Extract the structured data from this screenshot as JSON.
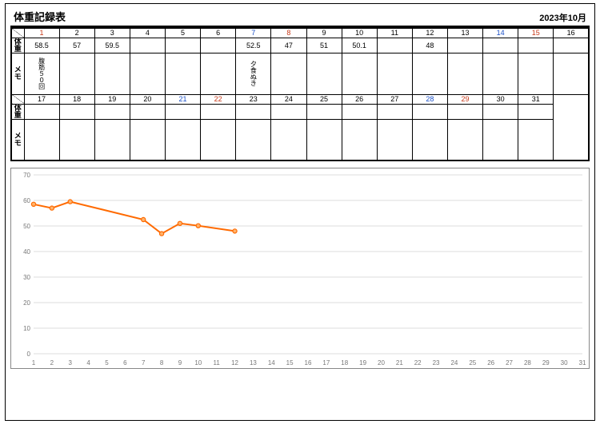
{
  "header": {
    "title": "体重記録表",
    "month": "2023年10月"
  },
  "labels": {
    "weight": "体重",
    "memo": "メモ"
  },
  "days_row1": [
    "1",
    "2",
    "3",
    "4",
    "5",
    "6",
    "7",
    "8",
    "9",
    "10",
    "11",
    "12",
    "13",
    "14",
    "15",
    "16"
  ],
  "days_row2": [
    "17",
    "18",
    "19",
    "20",
    "21",
    "22",
    "23",
    "24",
    "25",
    "26",
    "27",
    "28",
    "29",
    "30",
    "31"
  ],
  "day_of_week_row1": [
    "sun",
    "mon",
    "tue",
    "wed",
    "thu",
    "fri",
    "sat",
    "sun",
    "mon",
    "tue",
    "wed",
    "thu",
    "fri",
    "sat",
    "sun",
    "mon"
  ],
  "day_of_week_row2": [
    "tue",
    "wed",
    "thu",
    "fri",
    "sat",
    "sun",
    "mon",
    "tue",
    "wed",
    "thu",
    "fri",
    "sat",
    "sun",
    "mon",
    "tue"
  ],
  "weights_row1": [
    "58.5",
    "57",
    "59.5",
    "",
    "",
    "",
    "52.5",
    "47",
    "51",
    "50.1",
    "",
    "48",
    "",
    "",
    "",
    ""
  ],
  "weights_row2": [
    "",
    "",
    "",
    "",
    "",
    "",
    "",
    "",
    "",
    "",
    "",
    "",
    "",
    "",
    ""
  ],
  "memos_row1": [
    "腹筋５０回",
    "",
    "",
    "",
    "",
    "",
    "夕食ぬき",
    "",
    "",
    "",
    "",
    "",
    "",
    "",
    "",
    ""
  ],
  "memos_row2": [
    "",
    "",
    "",
    "",
    "",
    "",
    "",
    "",
    "",
    "",
    "",
    "",
    "",
    "",
    ""
  ],
  "chart_data": {
    "type": "line",
    "title": "",
    "xlabel": "",
    "ylabel": "",
    "x": [
      1,
      2,
      3,
      4,
      5,
      6,
      7,
      8,
      9,
      10,
      11,
      12,
      13,
      14,
      15,
      16,
      17,
      18,
      19,
      20,
      21,
      22,
      23,
      24,
      25,
      26,
      27,
      28,
      29,
      30,
      31
    ],
    "xlim": [
      1,
      31
    ],
    "ylim": [
      0,
      70
    ],
    "yticks": [
      0,
      10,
      20,
      30,
      40,
      50,
      60,
      70
    ],
    "series": [
      {
        "name": "体重",
        "points": [
          {
            "x": 1,
            "y": 58.5
          },
          {
            "x": 2,
            "y": 57
          },
          {
            "x": 3,
            "y": 59.5
          },
          {
            "x": 7,
            "y": 52.5
          },
          {
            "x": 8,
            "y": 47
          },
          {
            "x": 9,
            "y": 51
          },
          {
            "x": 10,
            "y": 50.1
          },
          {
            "x": 12,
            "y": 48
          }
        ],
        "segments": [
          [
            {
              "x": 1,
              "y": 58.5
            },
            {
              "x": 2,
              "y": 57
            },
            {
              "x": 3,
              "y": 59.5
            },
            {
              "x": 7,
              "y": 52.5
            },
            {
              "x": 8,
              "y": 47
            },
            {
              "x": 9,
              "y": 51
            },
            {
              "x": 10,
              "y": 50.1
            },
            {
              "x": 12,
              "y": 48
            }
          ]
        ]
      }
    ]
  }
}
